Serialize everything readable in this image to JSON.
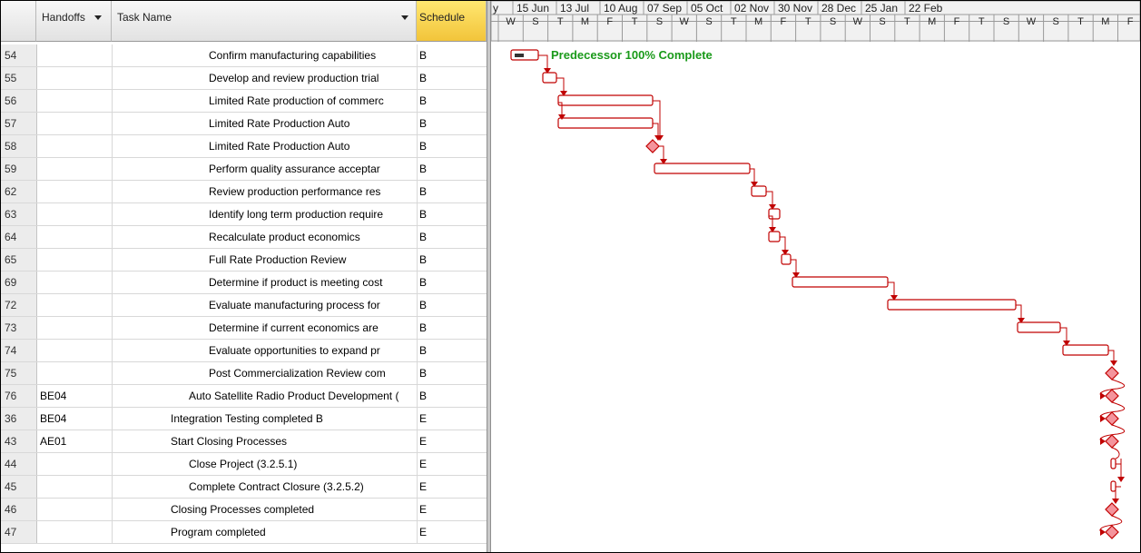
{
  "columns": {
    "handoffs": "Handoffs",
    "task_name": "Task Name",
    "schedule": "Schedule"
  },
  "timescale": {
    "months": [
      "y",
      "15 Jun",
      "13 Jul",
      "10 Aug",
      "07 Sep",
      "05 Oct",
      "02 Nov",
      "30 Nov",
      "28 Dec",
      "25 Jan",
      "22 Feb"
    ],
    "days": [
      "W",
      "S",
      "T",
      "M",
      "F",
      "T",
      "S",
      "W",
      "S",
      "T",
      "M",
      "F",
      "T",
      "S",
      "W",
      "S",
      "T",
      "M",
      "F",
      "T",
      "S",
      "W",
      "S",
      "T",
      "M",
      "F"
    ]
  },
  "annotation": "Predecessor 100% Complete",
  "rows": [
    {
      "id": "54",
      "handoff": "",
      "task": "Confirm manufacturing capabilities",
      "schedule": "B",
      "indent": 3
    },
    {
      "id": "55",
      "handoff": "",
      "task": "Develop and review production trial",
      "schedule": "B",
      "indent": 3
    },
    {
      "id": "56",
      "handoff": "",
      "task": "Limited Rate production of commerc",
      "schedule": "B",
      "indent": 3
    },
    {
      "id": "57",
      "handoff": "",
      "task": "Limited Rate Production Auto",
      "schedule": "B",
      "indent": 3
    },
    {
      "id": "58",
      "handoff": "",
      "task": "Limited Rate Production Auto",
      "schedule": "B",
      "indent": 3
    },
    {
      "id": "59",
      "handoff": "",
      "task": "Perform quality assurance acceptar",
      "schedule": "B",
      "indent": 3
    },
    {
      "id": "62",
      "handoff": "",
      "task": "Review production performance res",
      "schedule": "B",
      "indent": 3
    },
    {
      "id": "63",
      "handoff": "",
      "task": "Identify long term production require",
      "schedule": "B",
      "indent": 3
    },
    {
      "id": "64",
      "handoff": "",
      "task": "Recalculate product economics",
      "schedule": "B",
      "indent": 3
    },
    {
      "id": "65",
      "handoff": "",
      "task": "Full Rate Production Review",
      "schedule": "B",
      "indent": 3
    },
    {
      "id": "69",
      "handoff": "",
      "task": "Determine if product is meeting cost",
      "schedule": "B",
      "indent": 3
    },
    {
      "id": "72",
      "handoff": "",
      "task": "Evaluate manufacturing process for",
      "schedule": "B",
      "indent": 3
    },
    {
      "id": "73",
      "handoff": "",
      "task": "Determine if current economics are",
      "schedule": "B",
      "indent": 3
    },
    {
      "id": "74",
      "handoff": "",
      "task": "Evaluate opportunities to expand pr",
      "schedule": "B",
      "indent": 3
    },
    {
      "id": "75",
      "handoff": "",
      "task": "Post Commercialization Review com",
      "schedule": "B",
      "indent": 3
    },
    {
      "id": "76",
      "handoff": "BE04",
      "task": "Auto Satellite Radio Product Development (",
      "schedule": "B",
      "indent": 2
    },
    {
      "id": "36",
      "handoff": "BE04",
      "task": "Integration Testing completed B",
      "schedule": "E",
      "indent": 1
    },
    {
      "id": "43",
      "handoff": "AE01",
      "task": "Start Closing Processes",
      "schedule": "E",
      "indent": 1
    },
    {
      "id": "44",
      "handoff": "",
      "task": "Close Project (3.2.5.1)",
      "schedule": "E",
      "indent": 2
    },
    {
      "id": "45",
      "handoff": "",
      "task": "Complete Contract Closure (3.2.5.2)",
      "schedule": "E",
      "indent": 2
    },
    {
      "id": "46",
      "handoff": "",
      "task": "Closing Processes completed",
      "schedule": "E",
      "indent": 0
    },
    {
      "id": "47",
      "handoff": "",
      "task": "Program completed",
      "schedule": "E",
      "indent": 0
    }
  ],
  "colors": {
    "bar_outline": "#c00000",
    "annotation": "#1a9a1a",
    "schedule_header": "#f7d24a"
  }
}
